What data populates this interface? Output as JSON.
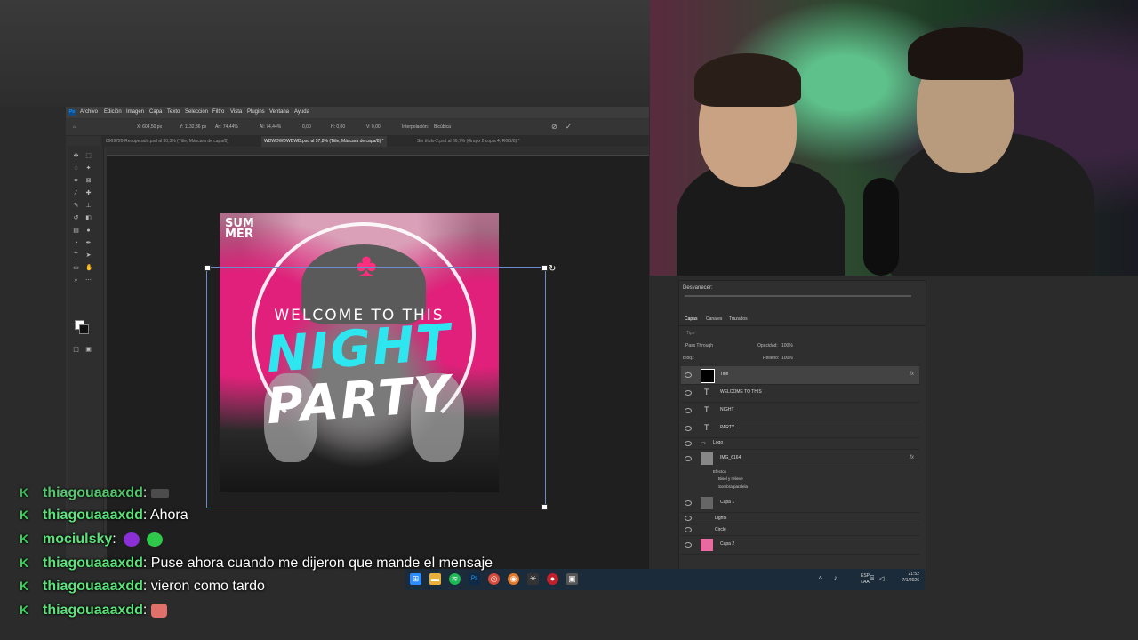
{
  "photoshop": {
    "menu": [
      "Archivo",
      "Edición",
      "Imagen",
      "Capa",
      "Texto",
      "Selección",
      "Filtro",
      "Vista",
      "Plugins",
      "Ventana",
      "Ayuda"
    ],
    "options": {
      "x": "X: 604,50 px",
      "y": "Y: 1132,86 px",
      "w": "An: 74,44%",
      "h": "Al: 74,44%",
      "angle": "0,00",
      "hskew": "H: 0,00",
      "vskew": "V: 0,00",
      "interp_label": "Interpolación:",
      "interp_value": "Bicúbica"
    },
    "tabs": [
      "8969720-Recuperado.psd al 30,3% (Title, Máscara de capa/8)",
      "WDWDWDWDWD.psd al 57,8% (Title, Máscara de capa/8) *",
      "Sin título-2.psd al 66,7% (Grupo 2 copia 4, RGB/8) *"
    ],
    "artwork": {
      "brand": "SUM MER",
      "welcome": "WELCOME TO THIS",
      "night": "NIGHT",
      "party": "PARTY"
    }
  },
  "layers_panel": {
    "header": "Desvanecer:",
    "tabs": [
      "Capas",
      "Canales",
      "Trazados"
    ],
    "search_placeholder": "Tipo",
    "blend_mode": "Pass Through",
    "opacity_label": "Opacidad:",
    "opacity_value": "100%",
    "fill_label": "Relleno:",
    "fill_value": "100%",
    "lock_label": "Bloq.:",
    "layers": [
      {
        "name": "Title",
        "type": "group",
        "fx": "fx",
        "selected": true
      },
      {
        "name": "WELCOME TO THIS",
        "type": "text"
      },
      {
        "name": "NIGHT",
        "type": "text"
      },
      {
        "name": "PARTY",
        "type": "text"
      },
      {
        "name": "Logo",
        "type": "group"
      },
      {
        "name": "IMG_6164",
        "type": "image",
        "fx": "fx"
      },
      {
        "name": "Capa 1",
        "type": "image"
      },
      {
        "name": "Lights",
        "type": "group"
      },
      {
        "name": "Circle",
        "type": "group"
      },
      {
        "name": "Capa 2",
        "type": "image"
      }
    ],
    "effects_label": "Efectos",
    "effects": [
      "Bisel y relieve",
      "Sombra paralela"
    ]
  },
  "taskbar": {
    "lang_top": "ESP",
    "lang_bottom": "LAA",
    "time": "21:52",
    "date": "7/1/2026"
  },
  "chat": [
    {
      "user": "thiagouaaaxdd",
      "text": ""
    },
    {
      "user": "thiagouaaaxdd",
      "text": "Ahora"
    },
    {
      "user": "mociulsky",
      "text": ""
    },
    {
      "user": "thiagouaaaxdd",
      "text": "Puse ahora cuando me dijeron que mande el mensaje"
    },
    {
      "user": "thiagouaaaxdd",
      "text": "vieron como tardo"
    },
    {
      "user": "thiagouaaaxdd",
      "text": ""
    }
  ],
  "colors": {
    "chat_user": "#5ce27a",
    "night_text": "#2ee6f0",
    "palm": "#ff2e7e"
  }
}
